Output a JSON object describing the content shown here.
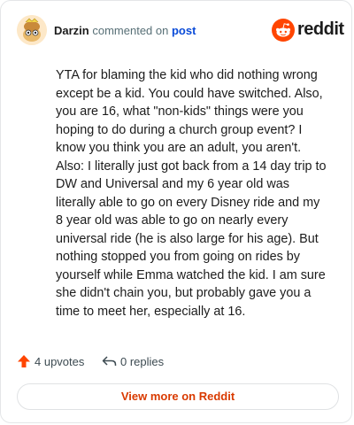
{
  "header": {
    "author": "Darzin",
    "commented_text": "commented on",
    "post_link": "post",
    "brand_name": "reddit",
    "brand_color": "#ff4500"
  },
  "comment": {
    "body": "YTA for blaming the kid who did nothing wrong except be a kid. You could have switched. Also, you are 16, what \"non-kids\" things were you hoping to do during a church group event? I know you think you are an adult, you aren't. Also: I literally just got back from a 14 day trip to DW and Universal and my 6 year old was literally able to go on every Disney ride and my 8 year old was able to go on nearly every universal ride (he is also large for his age). But nothing stopped you from going on rides by yourself while Emma watched the kid. I am sure she didn't chain you, but probably gave you a time to meet her, especially at 16."
  },
  "actions": {
    "upvotes": "4 upvotes",
    "replies": "0 replies",
    "upvote_icon": "upvote-arrow-icon",
    "reply_icon": "reply-arrow-icon"
  },
  "footer": {
    "view_more": "View more on Reddit"
  }
}
